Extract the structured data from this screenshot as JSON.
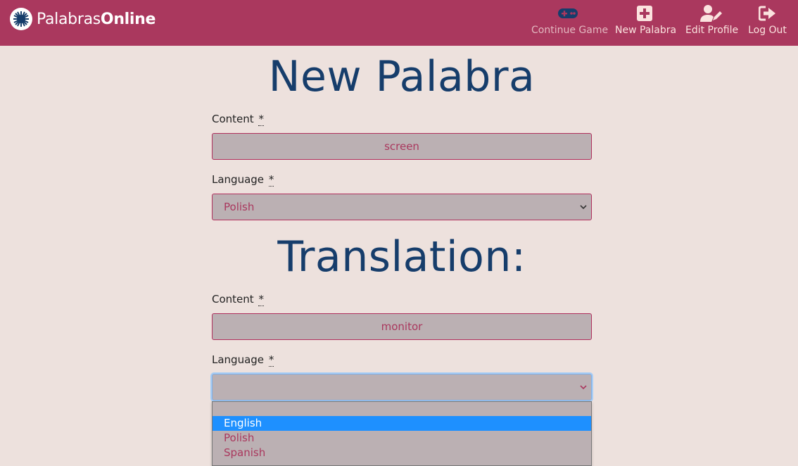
{
  "brand": {
    "name_part1": "Palabras",
    "name_part2": "Online",
    "logo_icon": "eye-logo-icon"
  },
  "nav": [
    {
      "label": "Continue Game",
      "icon": "gamepad-icon",
      "state": "muted"
    },
    {
      "label": "New Palabra",
      "icon": "plus-square-icon",
      "state": "active"
    },
    {
      "label": "Edit Profile",
      "icon": "user-edit-icon",
      "state": "active"
    },
    {
      "label": "Log Out",
      "icon": "logout-icon",
      "state": "active"
    }
  ],
  "form": {
    "title": "New Palabra",
    "content_label": "Content",
    "content_value": "screen",
    "language_label": "Language",
    "language_value": "Polish",
    "required_mark": "*"
  },
  "translation": {
    "title": "Translation:",
    "content_label": "Content",
    "content_value": "monitor",
    "language_label": "Language",
    "language_value": "",
    "dropdown_options": [
      "",
      "English",
      "Polish",
      "Spanish"
    ],
    "highlighted_option": "English"
  },
  "colors": {
    "navbar": "#aa385e",
    "background": "#ede1dd",
    "heading": "#163d6b",
    "input_bg": "#bbb0b3",
    "accent": "#aa385e",
    "highlight": "#1e90ff"
  }
}
